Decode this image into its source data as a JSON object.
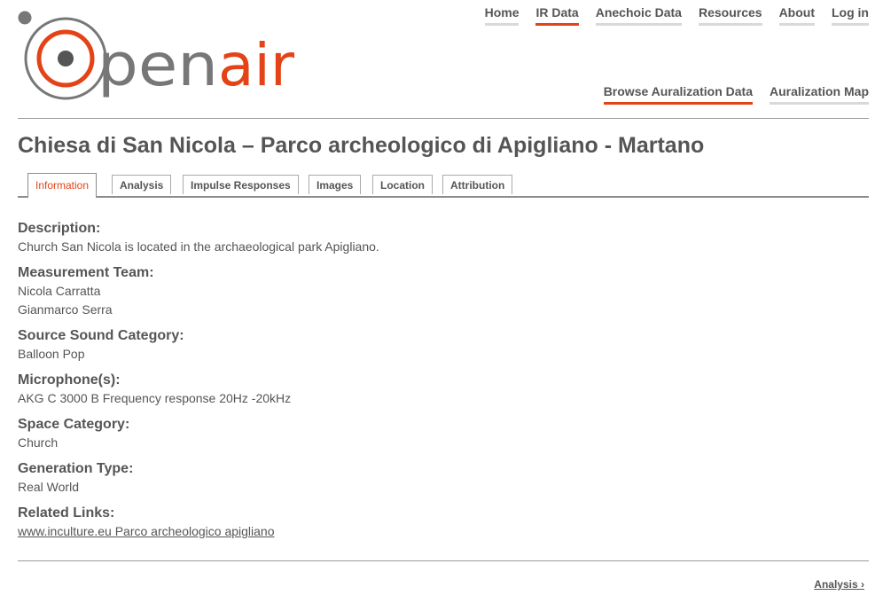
{
  "logo": {
    "text_plain": "pen",
    "text_accent": "air"
  },
  "main_nav": [
    {
      "label": "Home",
      "active": false
    },
    {
      "label": "IR Data",
      "active": true
    },
    {
      "label": "Anechoic Data",
      "active": false
    },
    {
      "label": "Resources",
      "active": false
    },
    {
      "label": "About",
      "active": false
    },
    {
      "label": "Log in",
      "active": false
    }
  ],
  "sub_nav": [
    {
      "label": "Browse Auralization Data",
      "active": true
    },
    {
      "label": "Auralization Map",
      "active": false
    }
  ],
  "page_title": "Chiesa di San Nicola – Parco archeologico di Apigliano - Martano",
  "tabs": [
    {
      "label": "Information",
      "active": true
    },
    {
      "label": "Analysis",
      "active": false
    },
    {
      "label": "Impulse Responses",
      "active": false
    },
    {
      "label": "Images",
      "active": false
    },
    {
      "label": "Location",
      "active": false
    },
    {
      "label": "Attribution",
      "active": false
    }
  ],
  "fields": {
    "description": {
      "label": "Description:",
      "value": "Church San Nicola is located in the archaeological park Apigliano."
    },
    "team": {
      "label": "Measurement Team:",
      "members": [
        "Nicola Carratta",
        "Gianmarco Serra"
      ]
    },
    "source": {
      "label": "Source Sound Category:",
      "value": "Balloon Pop"
    },
    "microphones": {
      "label": "Microphone(s):",
      "value": "AKG C 3000 B Frequency response 20Hz -20kHz"
    },
    "space": {
      "label": "Space Category:",
      "value": "Church"
    },
    "generation": {
      "label": "Generation Type:",
      "value": "Real World"
    },
    "links": {
      "label": "Related Links:",
      "link_text": "www.inculture.eu Parco archeologico apigliano"
    }
  },
  "pager": {
    "next_label": "Analysis ›"
  },
  "colors": {
    "accent": "#e34317",
    "text": "#555555",
    "rule": "#999999",
    "logo_grey": "#777777"
  },
  "icons": {
    "logo_mark": "openair-circle-logo-icon"
  }
}
